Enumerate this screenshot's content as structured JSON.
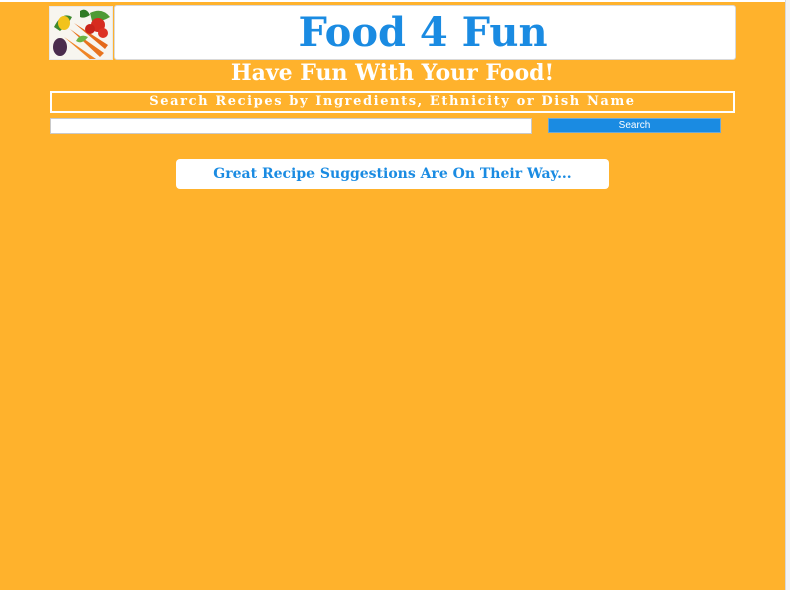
{
  "header": {
    "title": "Food 4 Fun",
    "tagline": "Have Fun With Your Food!"
  },
  "search": {
    "banner": "Search Recipes by Ingredients, Ethnicity or Dish Name",
    "value": "",
    "button_label": "Search"
  },
  "suggestions": {
    "message": "Great Recipe Suggestions Are On Their Way..."
  },
  "icons": {
    "logo": "vegetables-logo-icon"
  },
  "colors": {
    "background": "#ffb22c",
    "accent": "#1a8be2",
    "text_light": "#ffffff"
  }
}
